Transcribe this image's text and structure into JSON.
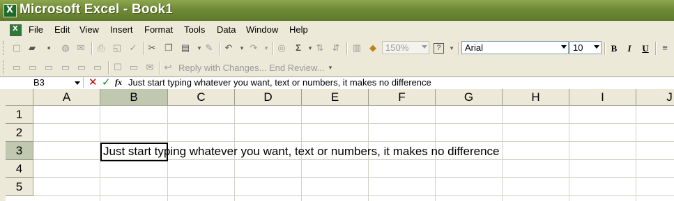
{
  "window": {
    "title": "Microsoft Excel - Book1"
  },
  "menu": [
    "File",
    "Edit",
    "View",
    "Insert",
    "Format",
    "Tools",
    "Data",
    "Window",
    "Help"
  ],
  "standard_toolbar": {
    "zoom": "150%"
  },
  "formatting_toolbar": {
    "font": "Arial",
    "size": "10",
    "bold": "B",
    "italic": "I",
    "underline": "U"
  },
  "reviewing_toolbar": {
    "reply_label": "Reply with Changes...",
    "end_review_label": "End Review..."
  },
  "formula_bar": {
    "name_box": "B3",
    "fx_label": "fx",
    "content": "Just start typing whatever you want, text or numbers, it makes no difference"
  },
  "sheet": {
    "columns": [
      "A",
      "B",
      "C",
      "D",
      "E",
      "F",
      "G",
      "H",
      "I",
      "J"
    ],
    "rows": [
      "1",
      "2",
      "3",
      "4",
      "5"
    ],
    "active_cell": "B3",
    "cells": {
      "B3": "Just start typing whatever you want, text or numbers, it makes no difference"
    }
  },
  "icons": [
    "excel-app-icon",
    "new-icon",
    "open-icon",
    "save-icon",
    "permission-icon",
    "email-icon",
    "print-icon",
    "print-preview-icon",
    "spelling-icon",
    "cut-icon",
    "copy-icon",
    "paste-icon",
    "format-painter-icon",
    "undo-icon",
    "redo-icon",
    "hyperlink-icon",
    "autosum-icon",
    "sort-ascending-icon",
    "sort-descending-icon",
    "chart-wizard-icon",
    "drawing-icon",
    "help-icon"
  ]
}
